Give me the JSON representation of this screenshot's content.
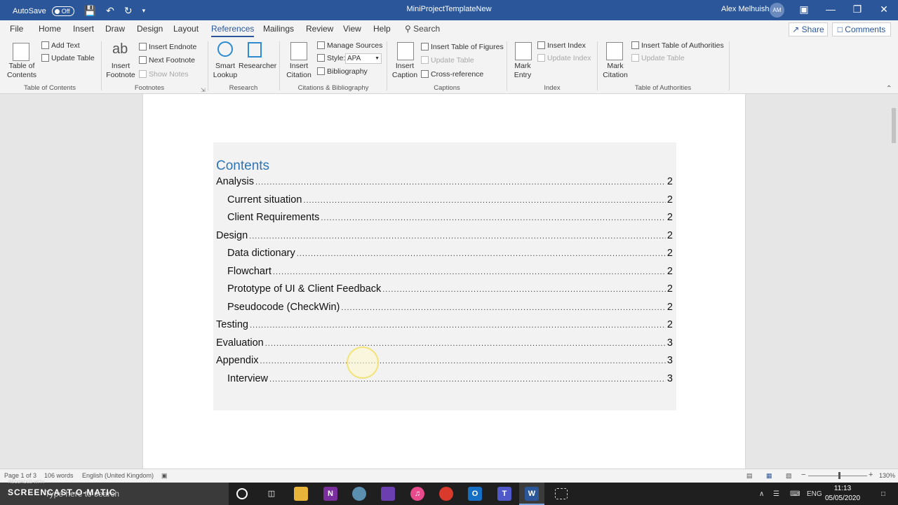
{
  "titlebar": {
    "autosave_label": "AutoSave",
    "autosave_state": "Off",
    "document_title": "MiniProjectTemplateNew",
    "user_name": "Alex Melhuish",
    "user_initials": "AM",
    "minimize": "—",
    "restore": "❐",
    "close": "✕"
  },
  "menu": {
    "tabs": [
      "File",
      "Home",
      "Insert",
      "Draw",
      "Design",
      "Layout",
      "References",
      "Mailings",
      "Review",
      "View",
      "Help"
    ],
    "active_tab": "References",
    "search": "Search",
    "share": "Share",
    "comments": "Comments"
  },
  "ribbon": {
    "toc": {
      "button_line1": "Table of",
      "button_line2": "Contents",
      "add_text": "Add Text",
      "update_table": "Update Table",
      "group": "Table of Contents"
    },
    "footnotes": {
      "insert_footnote_line1": "Insert",
      "insert_footnote_line2": "Footnote",
      "insert_endnote": "Insert Endnote",
      "next_footnote": "Next Footnote",
      "show_notes": "Show Notes",
      "group": "Footnotes",
      "ab_glyph": "ab"
    },
    "research": {
      "smart_lookup_line1": "Smart",
      "smart_lookup_line2": "Lookup",
      "researcher": "Researcher",
      "group": "Research"
    },
    "citations": {
      "insert_citation_line1": "Insert",
      "insert_citation_line2": "Citation",
      "manage_sources": "Manage Sources",
      "style_label": "Style:",
      "style_value": "APA",
      "bibliography": "Bibliography",
      "group": "Citations & Bibliography"
    },
    "captions": {
      "insert_caption_line1": "Insert",
      "insert_caption_line2": "Caption",
      "insert_table_of_figures": "Insert Table of Figures",
      "update_table": "Update Table",
      "cross_reference": "Cross-reference",
      "group": "Captions"
    },
    "index": {
      "mark_entry_line1": "Mark",
      "mark_entry_line2": "Entry",
      "insert_index": "Insert Index",
      "update_index": "Update Index",
      "group": "Index"
    },
    "authorities": {
      "mark_citation_line1": "Mark",
      "mark_citation_line2": "Citation",
      "insert_toa": "Insert Table of Authorities",
      "update_table": "Update Table",
      "group": "Table of Authorities"
    }
  },
  "document": {
    "toc_title": "Contents",
    "entries": [
      {
        "label": "Analysis",
        "page": "2",
        "level": 1
      },
      {
        "label": "Current situation",
        "page": "2",
        "level": 2
      },
      {
        "label": "Client Requirements",
        "page": "2",
        "level": 2
      },
      {
        "label": "Design",
        "page": "2",
        "level": 1
      },
      {
        "label": "Data dictionary",
        "page": "2",
        "level": 2
      },
      {
        "label": "Flowchart",
        "page": "2",
        "level": 2
      },
      {
        "label": "Prototype of UI & Client Feedback",
        "page": "2",
        "level": 2
      },
      {
        "label": "Pseudocode (CheckWin)",
        "page": "2",
        "level": 2
      },
      {
        "label": "Testing",
        "page": "2",
        "level": 1
      },
      {
        "label": "Evaluation",
        "page": "3",
        "level": 1
      },
      {
        "label": "Appendix",
        "page": "3",
        "level": 1
      },
      {
        "label": "Interview",
        "page": "3",
        "level": 2
      }
    ]
  },
  "status": {
    "page": "Page 1 of 3",
    "words": "106 words",
    "language": "English (United Kingdom)",
    "zoom": "130%",
    "zoom_minus": "−",
    "zoom_plus": "+"
  },
  "taskbar": {
    "watermark": "SCREENCAST-O-MATIC",
    "recorded_with": "RECORDED WITH",
    "search_placeholder": "Type here to search",
    "language": "ENG",
    "time": "11:13",
    "date": "05/05/2020",
    "chevron": "∧"
  }
}
